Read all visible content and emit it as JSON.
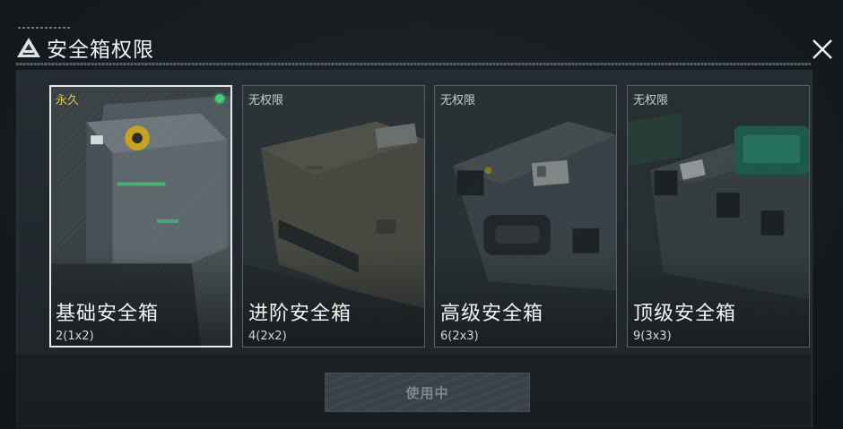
{
  "header": {
    "title": "安全箱权限"
  },
  "cards": [
    {
      "status": "永久",
      "name": "基础安全箱",
      "capacity": "2(1x2)",
      "selected": true
    },
    {
      "status": "无权限",
      "name": "进阶安全箱",
      "capacity": "4(2x2)",
      "selected": false
    },
    {
      "status": "无权限",
      "name": "高级安全箱",
      "capacity": "6(2x3)",
      "selected": false
    },
    {
      "status": "无权限",
      "name": "顶级安全箱",
      "capacity": "9(3x3)",
      "selected": false
    }
  ],
  "footer": {
    "use_button_label": "使用中"
  },
  "colors": {
    "permanent_status": "#e6c64a",
    "active_dot": "#3bd07a",
    "selected_border": "#e8ebec"
  }
}
